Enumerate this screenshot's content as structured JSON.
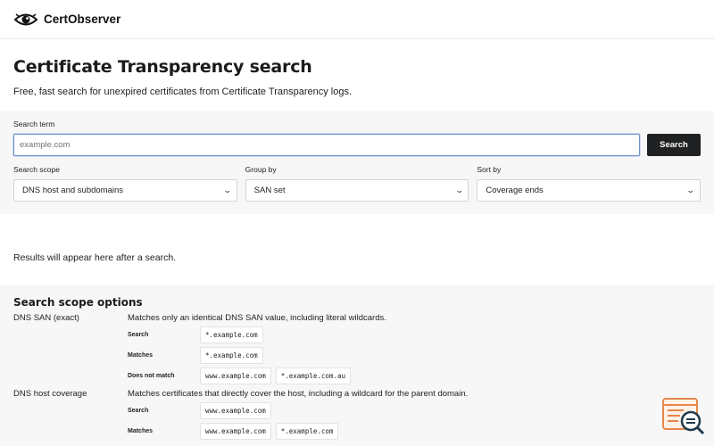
{
  "brand": {
    "name": "CertObserver"
  },
  "hero": {
    "title": "Certificate Transparency search",
    "subtitle": "Free, fast search for unexpired certificates from Certificate Transparency logs."
  },
  "form": {
    "search_label": "Search term",
    "search_placeholder": "example.com",
    "search_button": "Search",
    "scope": {
      "label": "Search scope",
      "value": "DNS host and subdomains"
    },
    "group": {
      "label": "Group by",
      "value": "SAN set"
    },
    "sort": {
      "label": "Sort by",
      "value": "Coverage ends"
    }
  },
  "results": {
    "placeholder": "Results will appear here after a search."
  },
  "scope_options": {
    "title": "Search scope options",
    "items": [
      {
        "name": "DNS SAN (exact)",
        "desc": "Matches only an identical DNS SAN value, including literal wildcards.",
        "examples": [
          {
            "label": "Search",
            "values": [
              "*.example.com"
            ]
          },
          {
            "label": "Matches",
            "values": [
              "*.example.com"
            ]
          },
          {
            "label": "Does not match",
            "values": [
              "www.example.com",
              "*.example.com.au"
            ]
          }
        ]
      },
      {
        "name": "DNS host coverage",
        "desc": "Matches certificates that directly cover the host, including a wildcard for the parent domain.",
        "examples": [
          {
            "label": "Search",
            "values": [
              "www.example.com"
            ]
          },
          {
            "label": "Matches",
            "values": [
              "www.example.com",
              "*.example.com"
            ]
          }
        ]
      }
    ]
  },
  "icons": {
    "logo": "eye-icon",
    "float": "search-log-icon"
  },
  "colors": {
    "accent": "#1f2123",
    "panel": "#f7f7f8",
    "float_accent": "#e8864a",
    "float_dark": "#1f3b4d"
  }
}
